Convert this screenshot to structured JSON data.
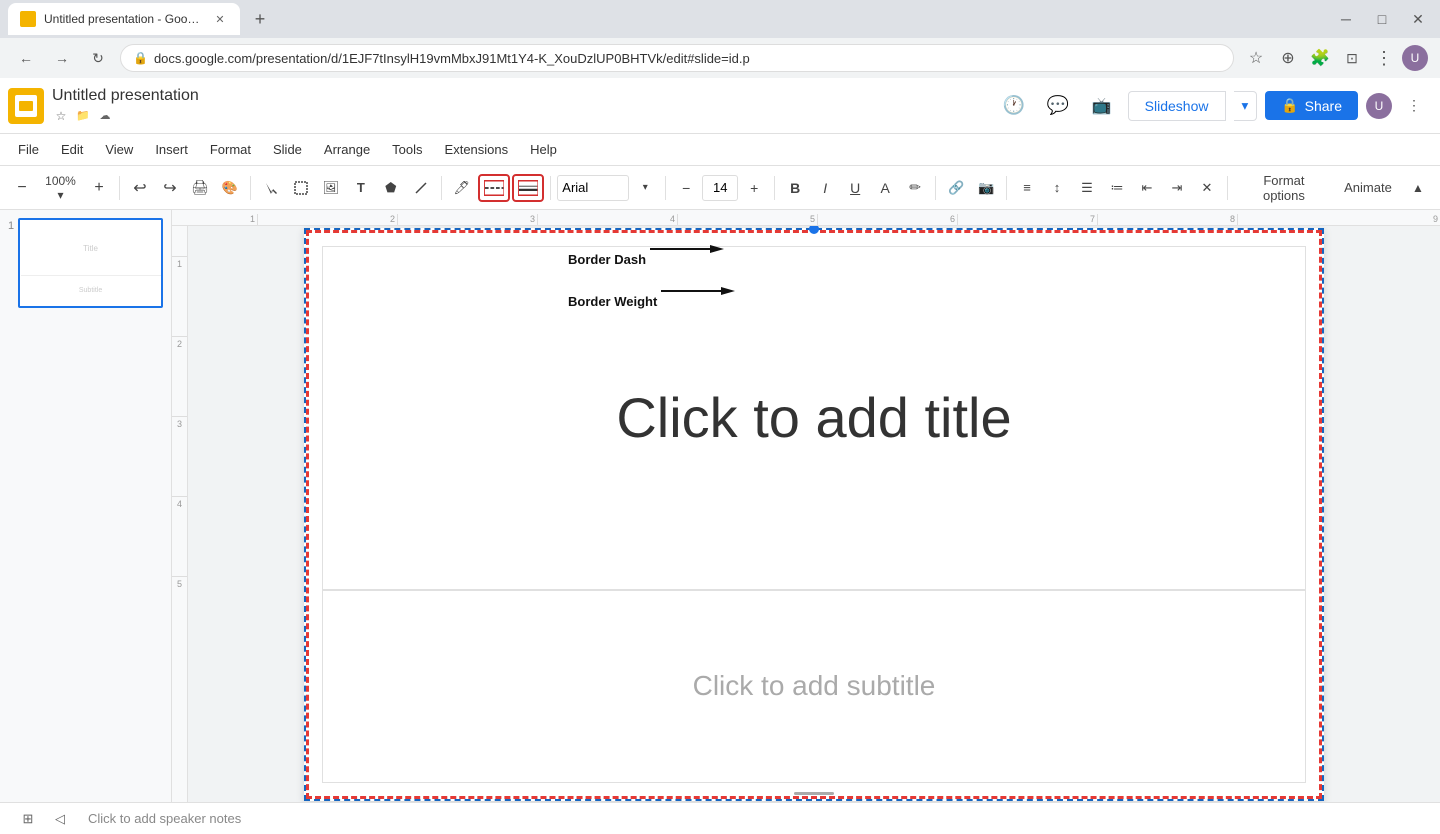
{
  "browser": {
    "tab_title": "Untitled presentation - Google S",
    "tab_favicon_color": "#f4b400",
    "url": "docs.google.com/presentation/d/1EJF7tInsylH19vmMbxJ91Mt1Y4-K_XouDzlUP0BHTVk/edit#slide=id.p",
    "new_tab_label": "+",
    "back_disabled": false,
    "forward_disabled": false
  },
  "app": {
    "title": "Untitled presentation",
    "logo_color": "#f4b400",
    "header_icons": [
      "star",
      "folder",
      "cloud"
    ],
    "slideshow_label": "Slideshow",
    "share_label": "Share"
  },
  "menu": {
    "items": [
      "File",
      "Edit",
      "View",
      "Insert",
      "Format",
      "Slide",
      "Arrange",
      "Tools",
      "Extensions",
      "Help"
    ]
  },
  "toolbar": {
    "zoom_label": "100%",
    "font_name": "Arial",
    "font_size": "14",
    "format_options_label": "Format options",
    "animate_label": "Animate",
    "border_dash_label": "Border Dash",
    "border_weight_label": "Border Weight"
  },
  "slide": {
    "number": 1,
    "title_placeholder": "Click to add title",
    "subtitle_placeholder": "Click to add subtitle",
    "border_color": "#1565c0",
    "selection_border_color": "#e53935"
  },
  "callouts": [
    {
      "id": "border-dash",
      "label": "Border Dash",
      "direction": "right-down"
    },
    {
      "id": "border-weight",
      "label": "Border Weight",
      "direction": "right-down"
    }
  ],
  "notes": {
    "placeholder": "Click to add speaker notes"
  },
  "ruler": {
    "h_marks": [
      "1",
      "2",
      "3",
      "4",
      "5",
      "6",
      "7",
      "8",
      "9"
    ],
    "v_marks": [
      "1",
      "2",
      "3",
      "4",
      "5"
    ]
  }
}
